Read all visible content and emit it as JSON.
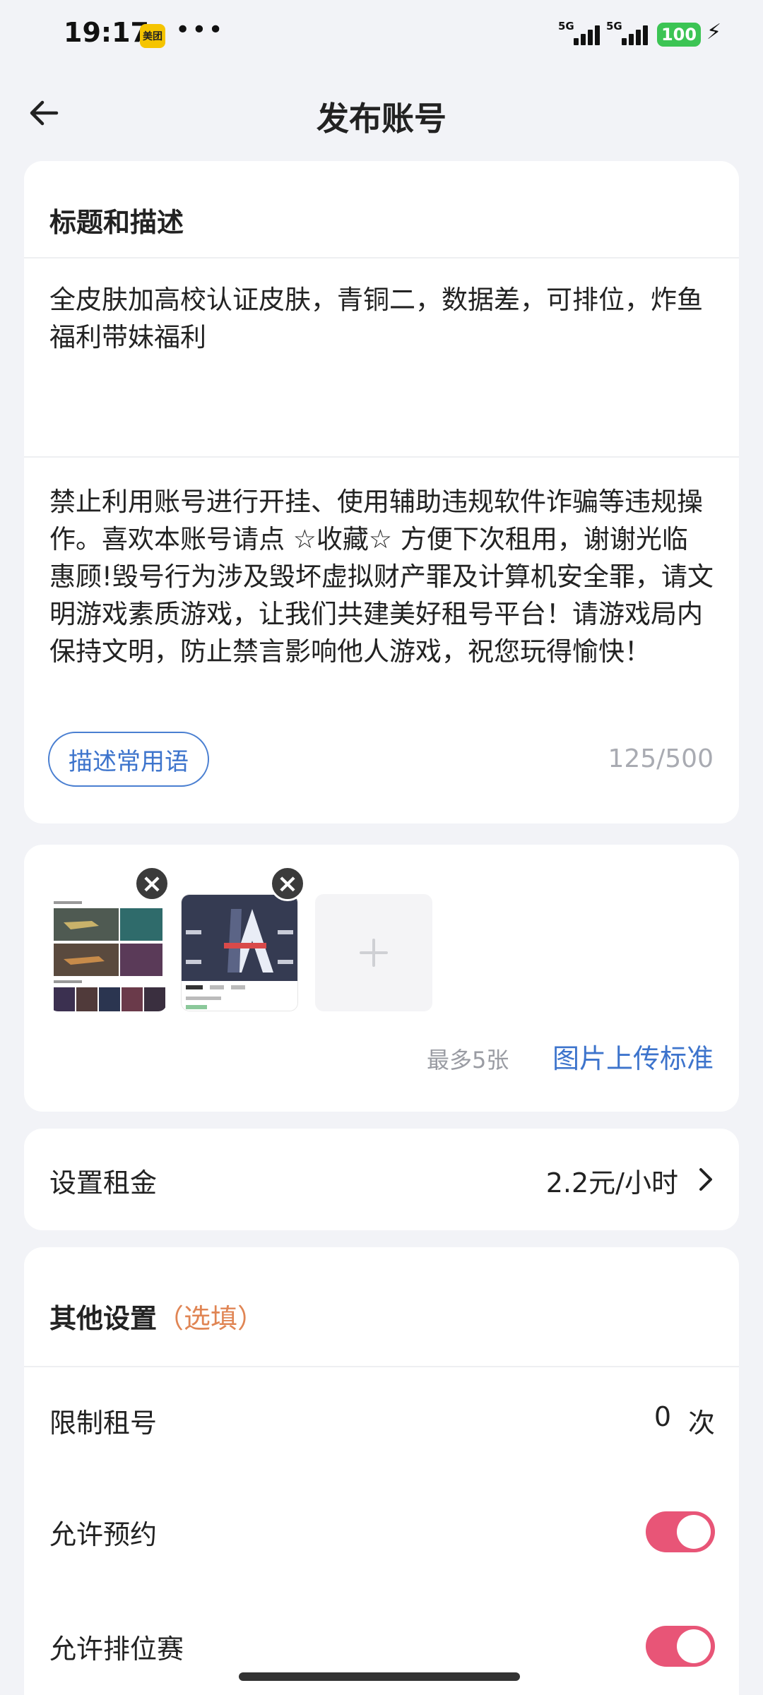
{
  "status_bar": {
    "time": "19:17",
    "app_badge": "美团",
    "more": "•••",
    "network_1": "5G",
    "network_2": "5G",
    "battery": "100"
  },
  "header": {
    "title": "发布账号",
    "back_icon": "arrow-left-icon"
  },
  "title_section": {
    "heading": "标题和描述",
    "title_text": "全皮肤加高校认证皮肤，青铜二，数据差，可排位，炸鱼福利带妹福利",
    "description_text": "禁止利用账号进行开挂、使用辅助违规软件诈骗等违规操作。喜欢本账号请点 ☆收藏☆ 方便下次租用，谢谢光临惠顾!毁号行为涉及毁坏虚拟财产罪及计算机安全罪，请文明游戏素质游戏，让我们共建美好租号平台！请游戏局内保持文明，防止禁言影响他人游戏，祝您玩得愉快！",
    "phrases_button": "描述常用语",
    "char_count": "125/500"
  },
  "images_section": {
    "max_note": "最多5张",
    "upload_standard": "图片上传标准"
  },
  "rent": {
    "label": "设置租金",
    "value": "2.2元/小时"
  },
  "other_settings": {
    "heading": "其他设置",
    "optional_tag": "（选填）",
    "limit_label": "限制租号",
    "limit_value": "0",
    "limit_unit": "次",
    "reservation_label": "允许预约",
    "reservation_enabled": true,
    "ranked_label": "允许排位赛",
    "ranked_enabled": true
  },
  "colors": {
    "accent_blue": "#3d74cc",
    "toggle_on": "#e85577",
    "optional_orange": "#e08554",
    "background": "#f2f3f7"
  }
}
